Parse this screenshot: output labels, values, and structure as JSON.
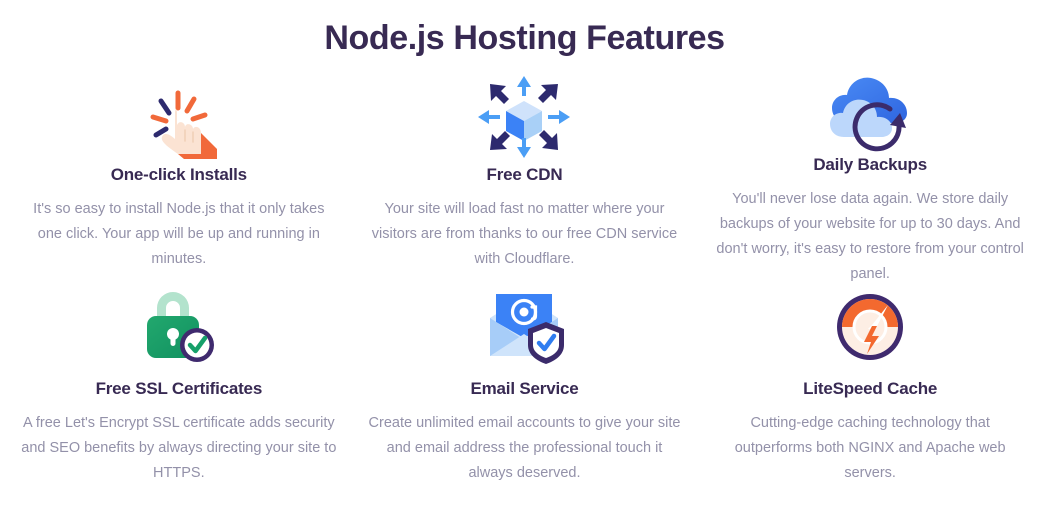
{
  "header": {
    "title": "Node.js Hosting Features"
  },
  "colors": {
    "heading": "#382a53",
    "body_text": "#9391a9",
    "background": "#ffffff",
    "orange": "#f1693a",
    "navy": "#2d2a6e",
    "blue": "#3b7ef0",
    "light_blue": "#8fc4f7",
    "green": "#16a06a",
    "purple_ring": "#3f2a6e"
  },
  "features": [
    {
      "icon": "click-hand-icon",
      "title": "One-click Installs",
      "description": "It's so easy to install Node.js that it only takes one click. Your app will be up and running in minutes."
    },
    {
      "icon": "cdn-cube-arrows-icon",
      "title": "Free CDN",
      "description": "Your site will load fast no matter where your visitors are from thanks to our free CDN service with Cloudflare."
    },
    {
      "icon": "cloud-backup-icon",
      "title": "Daily Backups",
      "description": "You'll never lose data again. We store daily backups of your website for up to 30 days. And don't worry, it's easy to restore from your control panel."
    },
    {
      "icon": "padlock-check-icon",
      "title": "Free SSL Certificates",
      "description": "A free Let's Encrypt SSL certificate adds security and SEO benefits by always directing your site to HTTPS."
    },
    {
      "icon": "email-shield-icon",
      "title": "Email Service",
      "description": "Create unlimited email accounts to give your site and email address the professional touch it always deserved."
    },
    {
      "icon": "speedometer-bolt-icon",
      "title": "LiteSpeed Cache",
      "description": "Cutting-edge caching technology that outperforms both NGINX and Apache web servers."
    }
  ]
}
